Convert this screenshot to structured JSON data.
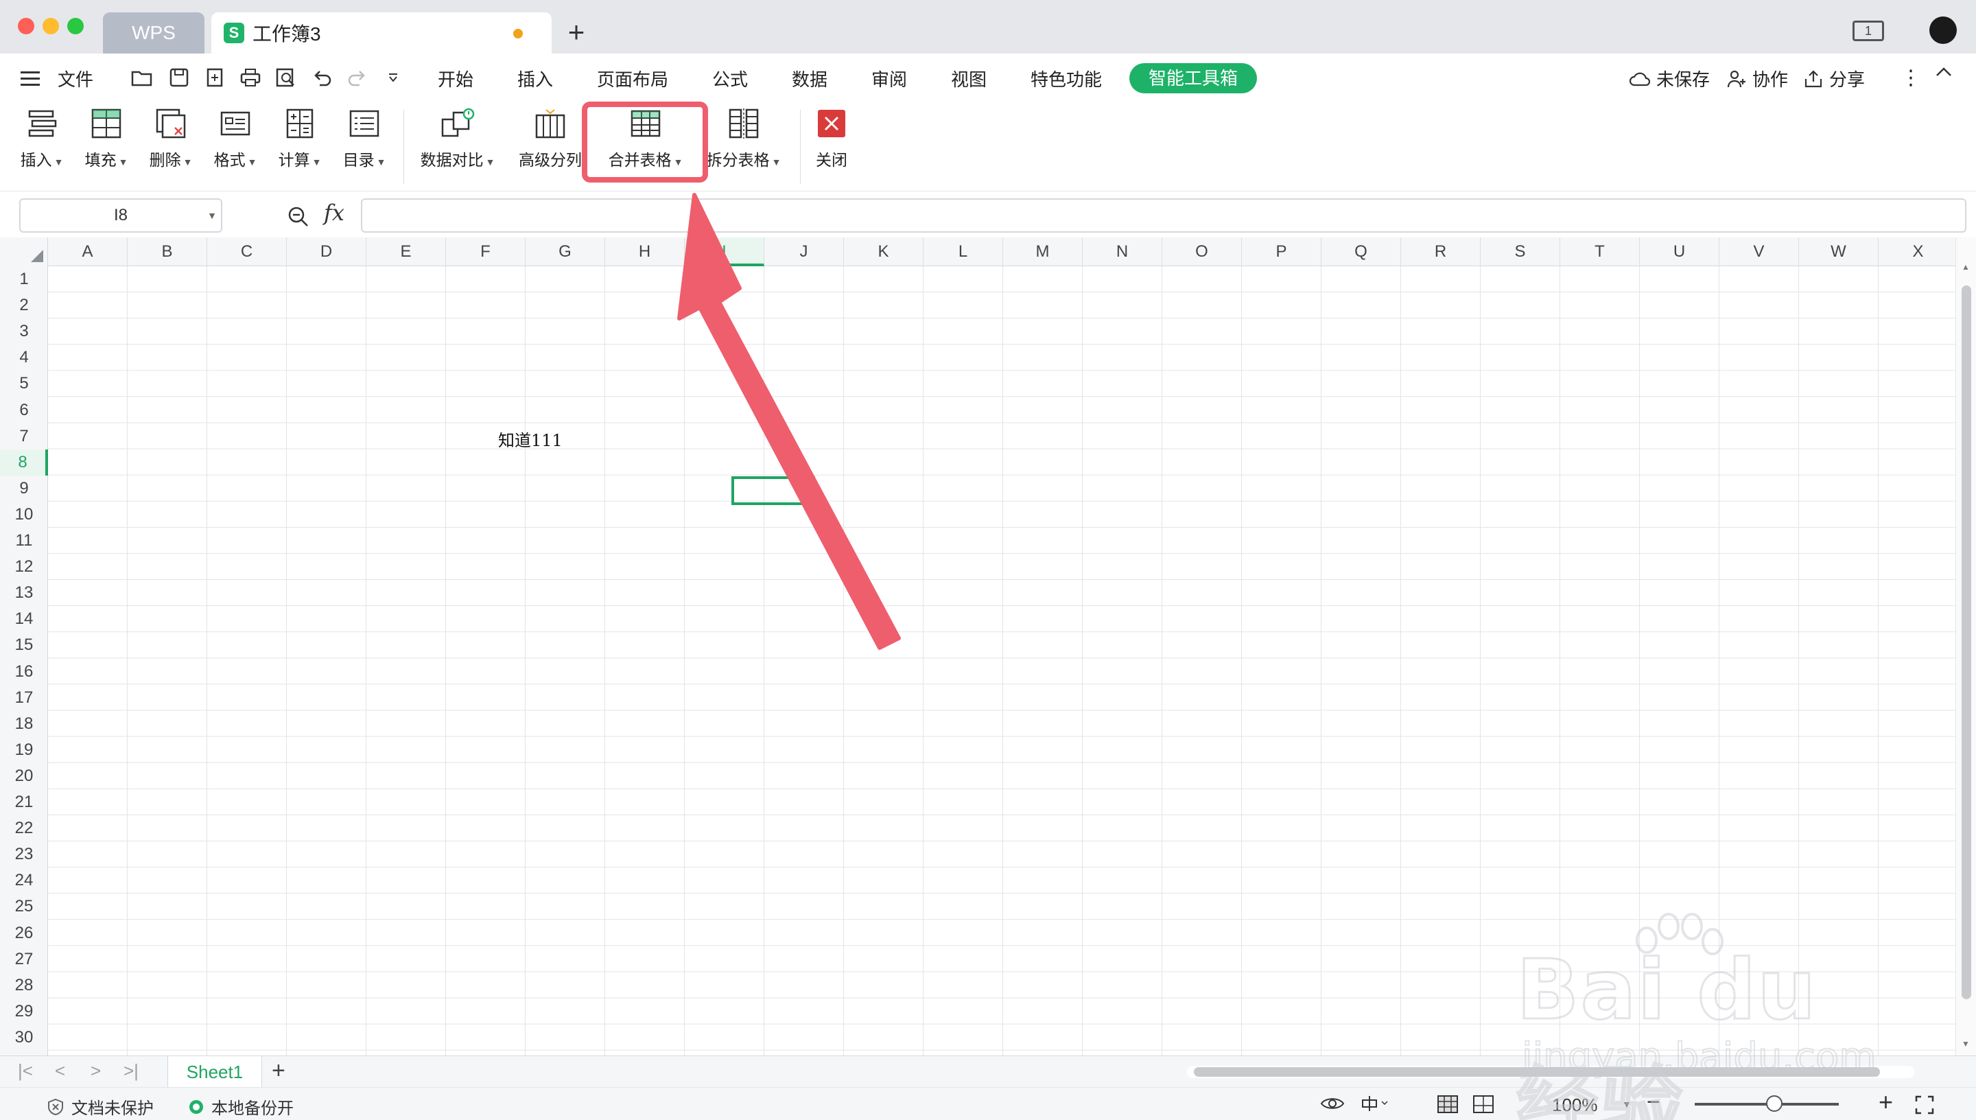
{
  "titlebar": {
    "tab_wps": "WPS",
    "tab_doc": "工作簿3",
    "doc_icon_letter": "S",
    "add_tab": "+",
    "layout_badge": "1"
  },
  "menubar": {
    "file": "文件",
    "tabs": [
      "开始",
      "插入",
      "页面布局",
      "公式",
      "数据",
      "审阅",
      "视图",
      "特色功能"
    ],
    "active_tab": "智能工具箱",
    "unsaved": "未保存",
    "collab": "协作",
    "share": "分享"
  },
  "ribbon": {
    "buttons": [
      {
        "label": "插入",
        "dropdown": true
      },
      {
        "label": "填充",
        "dropdown": true
      },
      {
        "label": "删除",
        "dropdown": true
      },
      {
        "label": "格式",
        "dropdown": true
      },
      {
        "label": "计算",
        "dropdown": true
      },
      {
        "label": "目录",
        "dropdown": true
      },
      {
        "label": "数据对比",
        "dropdown": true
      },
      {
        "label": "高级分列",
        "dropdown": false
      },
      {
        "label": "合并表格",
        "dropdown": true
      },
      {
        "label": "拆分表格",
        "dropdown": true
      },
      {
        "label": "关闭",
        "dropdown": false
      }
    ]
  },
  "formula_bar": {
    "name_box": "I8",
    "fx": "fx",
    "value": ""
  },
  "grid": {
    "columns": [
      "A",
      "B",
      "C",
      "D",
      "E",
      "F",
      "G",
      "H",
      "I",
      "J",
      "K",
      "L",
      "M",
      "N",
      "O",
      "P",
      "Q",
      "R",
      "S",
      "T",
      "U",
      "V",
      "W",
      "X"
    ],
    "rows": [
      "1",
      "2",
      "3",
      "4",
      "5",
      "6",
      "7",
      "8",
      "9",
      "10",
      "11",
      "12",
      "13",
      "14",
      "15",
      "16",
      "17",
      "18",
      "19",
      "20",
      "21",
      "22",
      "23",
      "24",
      "25",
      "26",
      "27",
      "28",
      "29",
      "30"
    ],
    "selected_column": "I",
    "selected_row": "8",
    "cell_F6": "知道111"
  },
  "sheets": {
    "tabs": [
      "Sheet1"
    ],
    "add": "+"
  },
  "statusbar": {
    "protect": "文档未保护",
    "backup": "本地备份开",
    "zoom": "100%"
  },
  "watermark": {
    "brand": "Bai du 经验",
    "url": "jingyan.baidu.com"
  },
  "colors": {
    "accent_green": "#1eb268",
    "highlight_red": "#ef5e6d",
    "close_red": "#d93b3b"
  }
}
